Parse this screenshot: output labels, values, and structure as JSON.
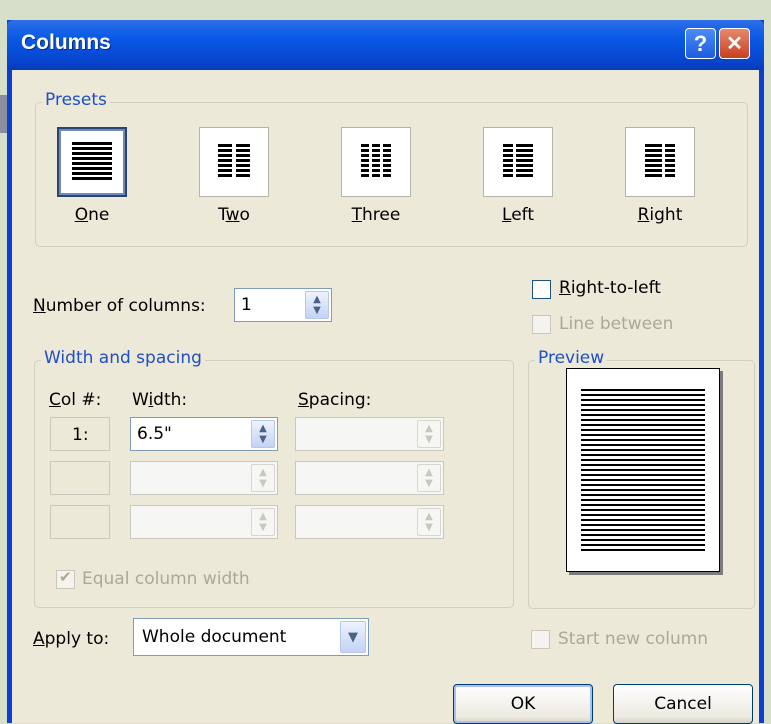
{
  "dialog": {
    "title": "Columns",
    "help_glyph": "?",
    "close_glyph": "✕"
  },
  "presets": {
    "label": "Presets",
    "items": [
      {
        "hotkey": "O",
        "rest": "ne",
        "selected": true
      },
      {
        "prefix": "T",
        "hotkey": "w",
        "rest": "o"
      },
      {
        "hotkey": "T",
        "rest": "hree"
      },
      {
        "hotkey": "L",
        "rest": "eft"
      },
      {
        "hotkey": "R",
        "rest": "ight"
      }
    ]
  },
  "number_of_columns": {
    "label_hotkey": "N",
    "label_rest": "umber of columns:",
    "value": "1"
  },
  "right_to_left": {
    "hotkey": "R",
    "rest": "ight-to-left",
    "checked": false
  },
  "line_between": {
    "label": "Line between",
    "checked": false,
    "enabled": false
  },
  "width_spacing": {
    "label": "Width and spacing",
    "col_header_hotkey": "C",
    "col_header_rest": "ol #:",
    "width_header_pre": "W",
    "width_header_hotkey": "i",
    "width_header_rest": "dth:",
    "spacing_header_hotkey": "S",
    "spacing_header_rest": "pacing:",
    "rows": [
      {
        "col": "1:",
        "width": "6.5\"",
        "spacing": ""
      },
      {
        "col": "",
        "width": "",
        "spacing": ""
      },
      {
        "col": "",
        "width": "",
        "spacing": ""
      }
    ],
    "equal_width": {
      "label": "Equal column width",
      "checked": true,
      "enabled": false
    }
  },
  "preview": {
    "label": "Preview"
  },
  "apply_to": {
    "label_hotkey": "A",
    "label_rest": "pply to:",
    "value": "Whole document"
  },
  "start_new_column": {
    "label": "Start new column",
    "checked": false,
    "enabled": false
  },
  "buttons": {
    "ok": "OK",
    "cancel": "Cancel"
  }
}
